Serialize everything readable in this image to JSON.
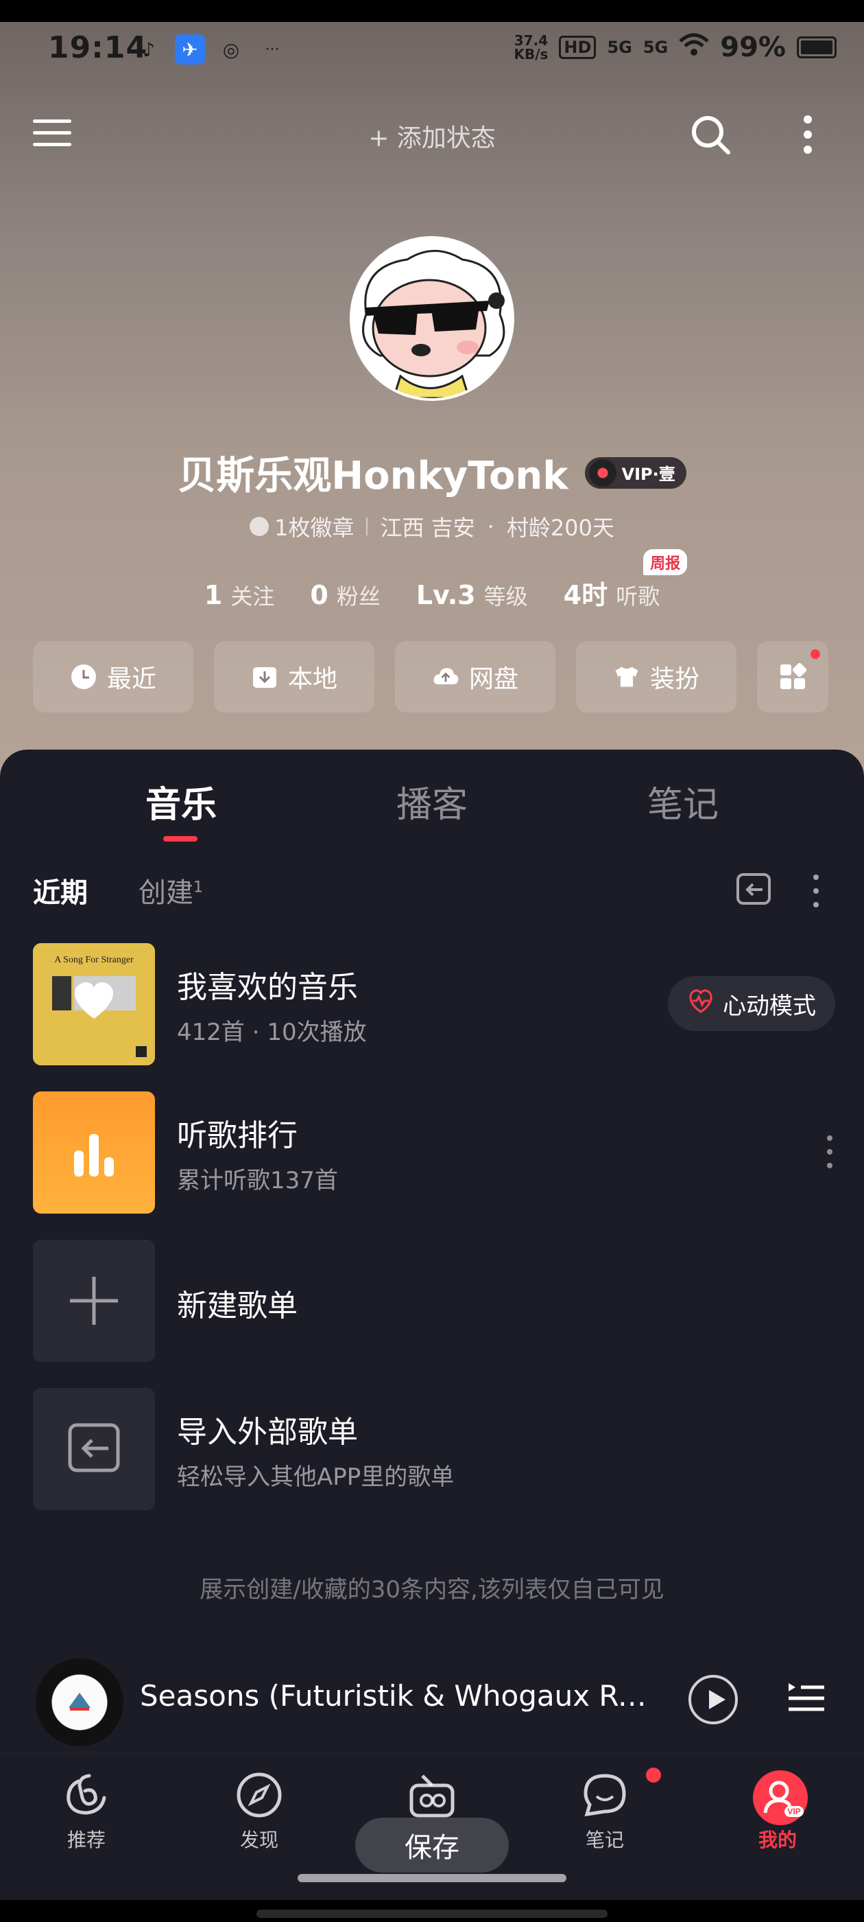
{
  "status_bar": {
    "time": "19:14",
    "net_speed_value": "37.4",
    "net_speed_unit": "KB/s",
    "hd": "HD",
    "signal1": "5G",
    "signal2": "5G",
    "battery": "99%"
  },
  "topbar": {
    "add_status": "+ 添加状态"
  },
  "profile": {
    "username": "贝斯乐观HonkyTonk",
    "vip_label": "VIP·壹",
    "badges": "1枚徽章",
    "location": "江西 吉安",
    "village_age": "村龄200天",
    "stats": [
      {
        "num": "1",
        "label": "关注"
      },
      {
        "num": "0",
        "label": "粉丝"
      },
      {
        "num": "Lv.3",
        "label": "等级"
      },
      {
        "num": "4时",
        "label": "听歌"
      }
    ],
    "weekly_tag": "周报"
  },
  "quick_buttons": [
    {
      "label": "最近",
      "icon": "clock-icon"
    },
    {
      "label": "本地",
      "icon": "download-icon"
    },
    {
      "label": "网盘",
      "icon": "cloud-upload-icon"
    },
    {
      "label": "装扮",
      "icon": "shirt-icon"
    }
  ],
  "tabs": [
    "音乐",
    "播客",
    "笔记"
  ],
  "subtabs": {
    "recent": "近期",
    "created": "创建",
    "created_count": "1"
  },
  "list": [
    {
      "title": "我喜欢的音乐",
      "sub": "412首 · 10次播放",
      "cover_text": "A Song For Stranger",
      "action": "心动模式"
    },
    {
      "title": "听歌排行",
      "sub": "累计听歌137首"
    },
    {
      "title": "新建歌单"
    },
    {
      "title": "导入外部歌单",
      "sub": "轻松导入其他APP里的歌单"
    }
  ],
  "footnote": "展示创建/收藏的30条内容,该列表仅自己可见",
  "player": {
    "title": "Seasons (Futuristik & Whogaux Remi..."
  },
  "nav": [
    {
      "label": "推荐",
      "icon": "netease-icon"
    },
    {
      "label": "发现",
      "icon": "compass-icon"
    },
    {
      "label": "",
      "icon": "radio-icon"
    },
    {
      "label": "笔记",
      "icon": "chat-icon"
    },
    {
      "label": "我的",
      "icon": "user-vip-icon"
    }
  ],
  "save_toast": "保存",
  "colors": {
    "accent": "#ff3a4a",
    "sheet_bg": "#1c1c26"
  }
}
